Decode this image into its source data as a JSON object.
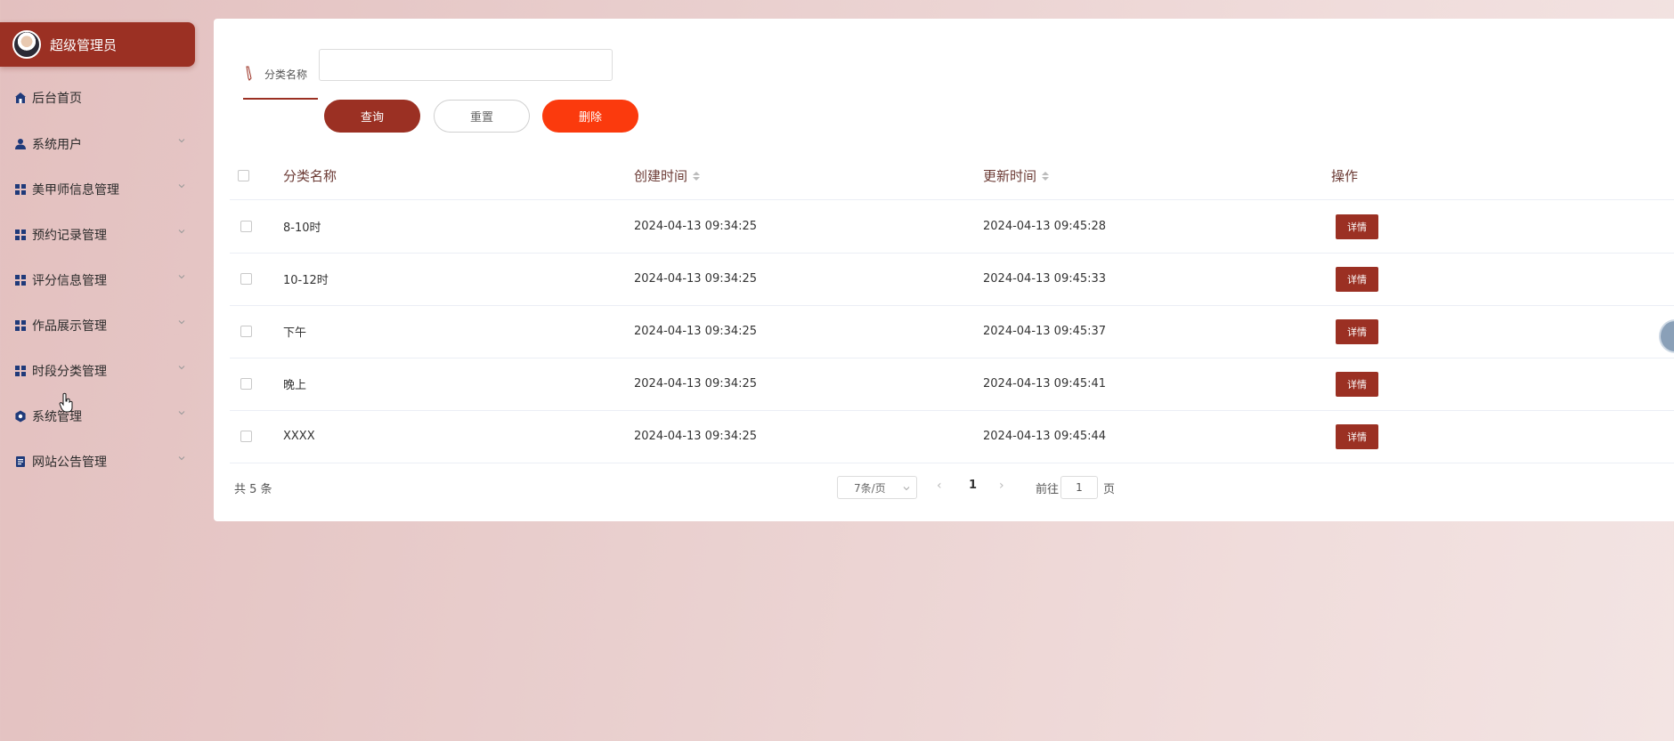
{
  "user": {
    "name": "超级管理员"
  },
  "menu": [
    {
      "label": "后台首页",
      "icon": "home-icon"
    },
    {
      "label": "系统用户",
      "icon": "user-icon"
    },
    {
      "label": "美甲师信息管理",
      "icon": "grid-icon"
    },
    {
      "label": "预约记录管理",
      "icon": "grid-icon"
    },
    {
      "label": "评分信息管理",
      "icon": "grid-icon"
    },
    {
      "label": "作品展示管理",
      "icon": "grid-icon"
    },
    {
      "label": "时段分类管理",
      "icon": "grid-icon"
    },
    {
      "label": "系统管理",
      "icon": "gear-icon"
    },
    {
      "label": "网站公告管理",
      "icon": "document-icon"
    }
  ],
  "search": {
    "label": "分类名称",
    "value": ""
  },
  "buttons": {
    "query": "查询",
    "reset": "重置",
    "delete": "删除"
  },
  "table": {
    "headers": {
      "name": "分类名称",
      "created": "创建时间",
      "updated": "更新时间",
      "actions": "操作"
    },
    "rows": [
      {
        "name": "8-10时",
        "created": "2024-04-13 09:34:25",
        "updated": "2024-04-13 09:45:28",
        "action": "详情"
      },
      {
        "name": "10-12时",
        "created": "2024-04-13 09:34:25",
        "updated": "2024-04-13 09:45:33",
        "action": "详情"
      },
      {
        "name": "下午",
        "created": "2024-04-13 09:34:25",
        "updated": "2024-04-13 09:45:37",
        "action": "详情"
      },
      {
        "name": "晚上",
        "created": "2024-04-13 09:34:25",
        "updated": "2024-04-13 09:45:41",
        "action": "详情"
      },
      {
        "name": "XXXX",
        "created": "2024-04-13 09:34:25",
        "updated": "2024-04-13 09:45:44",
        "action": "详情"
      }
    ]
  },
  "pagination": {
    "total": "共 5 条",
    "page_size": "7条/页",
    "current_page": "1",
    "goto_label": "前往",
    "goto_value": "1",
    "page_unit": "页"
  },
  "colors": {
    "primary": "#9b3023",
    "danger": "#fb3a0d"
  }
}
